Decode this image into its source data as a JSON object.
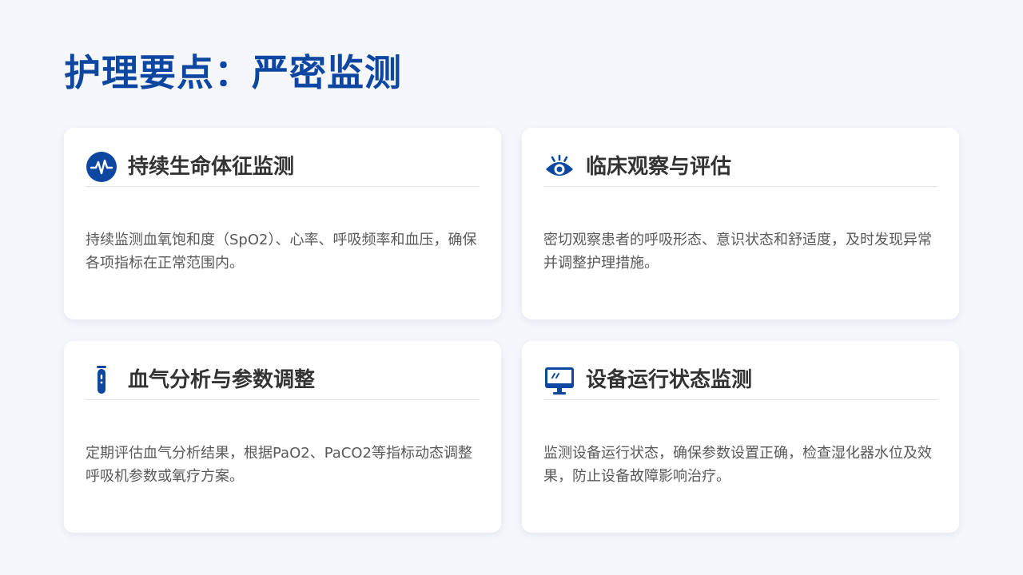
{
  "page": {
    "title": "护理要点：严密监测"
  },
  "cards": [
    {
      "title": "持续生命体征监测",
      "body": "持续监测血氧饱和度（SpO2）、心率、呼吸频率和血压，确保各项指标在正常范围内。",
      "icon": "heartbeat-pulse-icon"
    },
    {
      "title": "临床观察与评估",
      "body": "密切观察患者的呼吸形态、意识状态和舒适度，及时发现异常并调整护理措施。",
      "icon": "eye-icon"
    },
    {
      "title": "血气分析与参数调整",
      "body": "定期评估血气分析结果，根据PaO2、PaCO2等指标动态调整呼吸机参数或氧疗方案。",
      "icon": "test-tube-icon"
    },
    {
      "title": "设备运行状态监测",
      "body": "监测设备运行状态，确保参数设置正确，检查湿化器水位及效果，防止设备故障影响治疗。",
      "icon": "monitor-icon"
    }
  ],
  "colors": {
    "primary": "#0d47a1",
    "background": "#f5f7fb",
    "card": "#ffffff",
    "title_text": "#333333",
    "body_text": "#595959"
  }
}
